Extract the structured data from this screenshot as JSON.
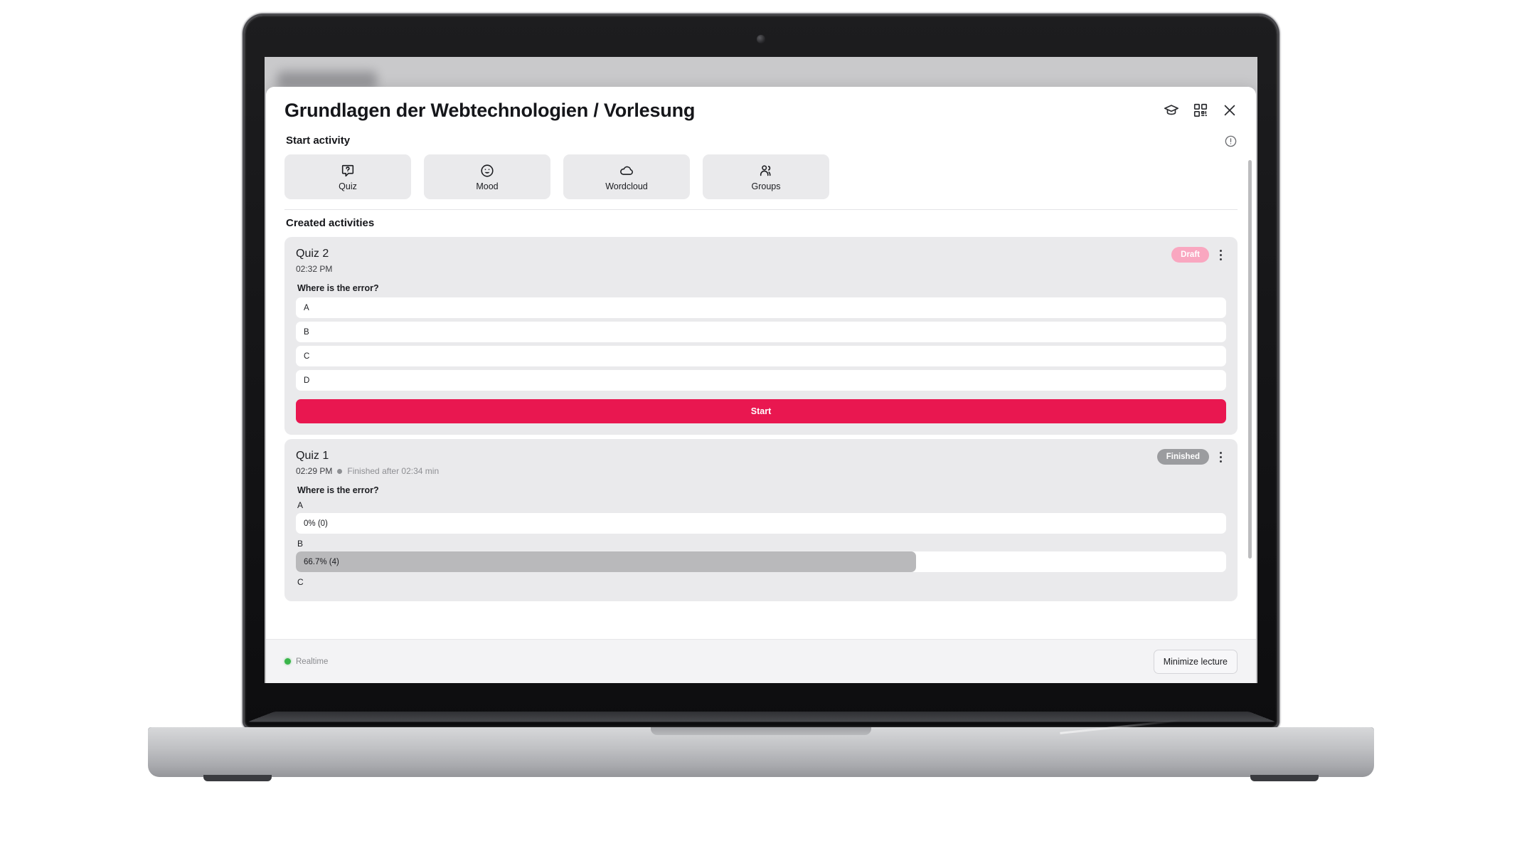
{
  "window": {
    "title": "Grundlagen der Webtechnologien / Vorlesung",
    "header_icons": [
      {
        "name": "graduation-cap-icon",
        "label": "Lecture"
      },
      {
        "name": "qr-code-icon",
        "label": "QR code"
      },
      {
        "name": "close-icon",
        "label": "Close"
      }
    ]
  },
  "start_activity": {
    "section_label": "Start activity",
    "info_icon": "info-circle-icon",
    "buttons": [
      {
        "label": "Quiz",
        "icon": "quiz-bubble-question-icon"
      },
      {
        "label": "Mood",
        "icon": "mood-smiley-icon"
      },
      {
        "label": "Wordcloud",
        "icon": "cloud-icon"
      },
      {
        "label": "Groups",
        "icon": "groups-people-icon"
      }
    ]
  },
  "created_activities": {
    "section_label": "Created activities",
    "cards": [
      {
        "title": "Quiz 2",
        "time": "02:32 PM",
        "status_extra": "",
        "badge": "Draft",
        "badge_type": "draft",
        "question": "Where is the error?",
        "mode": "draft",
        "options": [
          {
            "label": "A"
          },
          {
            "label": "B"
          },
          {
            "label": "C"
          },
          {
            "label": "D"
          }
        ],
        "start_label": "Start"
      },
      {
        "title": "Quiz 1",
        "time": "02:29 PM",
        "status_extra": "Finished after 02:34 min",
        "badge": "Finished",
        "badge_type": "finished",
        "question": "Where is the error?",
        "mode": "results",
        "results": [
          {
            "label": "A",
            "text": "0% (0)",
            "percent": 0
          },
          {
            "label": "B",
            "text": "66.7% (4)",
            "percent": 66.7
          },
          {
            "label": "C",
            "text": "",
            "percent": 0
          }
        ]
      }
    ]
  },
  "footer": {
    "realtime_label": "Realtime",
    "realtime_dot_color": "#39b54a",
    "minimize_label": "Minimize lecture"
  },
  "colors": {
    "accent": "#e91750",
    "draft_badge": "#f9a7c0",
    "finished_badge": "#9b9c9f",
    "card_bg": "#eaeaec",
    "bar_fill": "#b9b9bb"
  }
}
